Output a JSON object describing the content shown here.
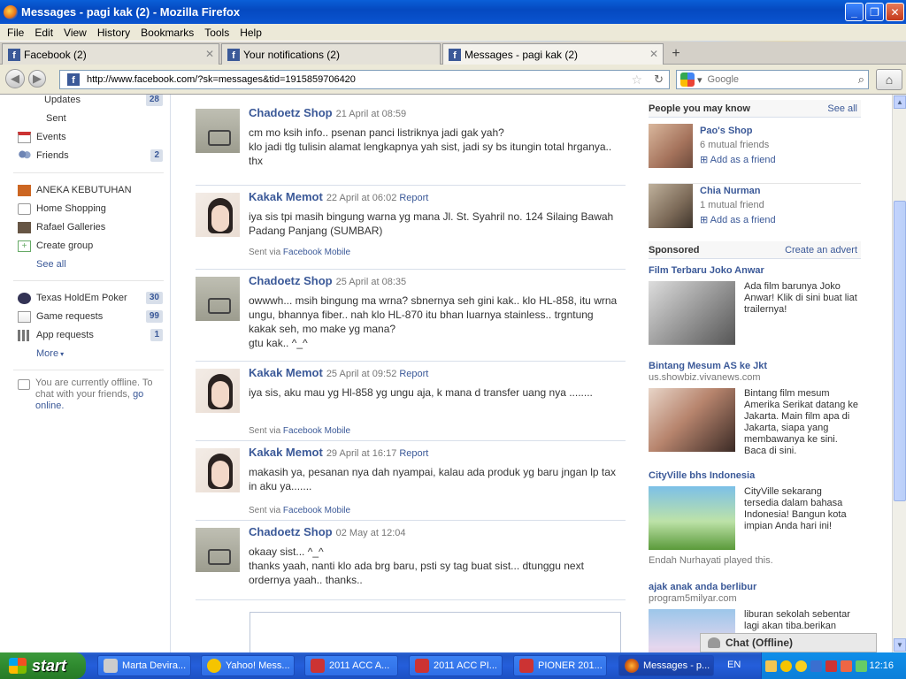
{
  "window": {
    "title": "Messages - pagi kak (2) - Mozilla Firefox"
  },
  "menu": [
    "File",
    "Edit",
    "View",
    "History",
    "Bookmarks",
    "Tools",
    "Help"
  ],
  "tabs": [
    {
      "label": "Facebook (2)"
    },
    {
      "label": "Your notifications (2)"
    },
    {
      "label": "Messages - pagi kak (2)"
    }
  ],
  "url": "http://www.facebook.com/?sk=messages&tid=1915859706420",
  "search": {
    "placeholder": "Google"
  },
  "left_nav": {
    "updates": {
      "label": "Updates",
      "count": "28"
    },
    "sent": {
      "label": "Sent"
    },
    "events": {
      "label": "Events"
    },
    "friends": {
      "label": "Friends",
      "count": "2"
    },
    "groups": [
      {
        "label": "ANEKA KEBUTUHAN"
      },
      {
        "label": "Home Shopping"
      },
      {
        "label": "Rafael Galleries"
      },
      {
        "label": "Create group"
      }
    ],
    "see_all": "See all",
    "apps": [
      {
        "label": "Texas HoldEm Poker",
        "count": "30"
      },
      {
        "label": "Game requests",
        "count": "99"
      },
      {
        "label": "App requests",
        "count": "1"
      }
    ],
    "more": "More",
    "offline_text": "You are currently offline. To chat with your friends,",
    "go_online": "go online."
  },
  "messages": [
    {
      "name": "Chadoetz Shop",
      "date": "21 April at 08:59",
      "report": "",
      "body": "cm mo ksih info.. psenan panci listriknya jadi gak yah?\nklo jadi tlg tulisin alamat lengkapnya yah sist, jadi sy bs itungin total hrganya.. thx",
      "via": ""
    },
    {
      "name": "Kakak Memot",
      "date": "22 April at 06:02",
      "report": "Report",
      "body": "iya sis tpi masih bingung warna yg mana Jl. St. Syahril no. 124 Silaing Bawah Padang Panjang (SUMBAR)",
      "via": "Facebook Mobile"
    },
    {
      "name": "Chadoetz Shop",
      "date": "25 April at 08:35",
      "report": "",
      "body": "owwwh... msih bingung ma wrna? sbnernya seh gini kak.. klo HL-858, itu wrna ungu, bhannya fiber.. nah klo HL-870 itu bhan luarnya stainless.. trgntung kakak seh, mo make yg mana?\ngtu kak.. ^_^",
      "via": ""
    },
    {
      "name": "Kakak Memot",
      "date": "25 April at 09:52",
      "report": "Report",
      "body": "iya sis, aku mau yg Hl-858 yg ungu aja, k mana d transfer uang nya ........",
      "via": "Facebook Mobile"
    },
    {
      "name": "Kakak Memot",
      "date": "29 April at 16:17",
      "report": "Report",
      "body": "makasih ya, pesanan nya dah nyampai, kalau ada produk yg baru jngan lp tax in aku ya.......",
      "via": "Facebook Mobile"
    },
    {
      "name": "Chadoetz Shop",
      "date": "02 May at 12:04",
      "report": "",
      "body": "okaay sist... ^_^\nthanks yaah, nanti klo ada brg baru, psti sy tag buat sist... dtunggu next ordernya yaah.. thanks..",
      "via": ""
    }
  ],
  "via_prefix": "Sent via",
  "pymk": {
    "title": "People you may know",
    "see_all": "See all",
    "people": [
      {
        "name": "Pao's Shop",
        "mutual": "6 mutual friends",
        "add": "Add as a friend"
      },
      {
        "name": "Chia Nurman",
        "mutual": "1 mutual friend",
        "add": "Add as a friend"
      }
    ]
  },
  "sponsored": {
    "title": "Sponsored",
    "create": "Create an advert",
    "ads": [
      {
        "title": "Film Terbaru Joko Anwar",
        "domain": "",
        "text": "Ada film barunya Joko Anwar! Klik di sini buat liat trailernya!",
        "footer": ""
      },
      {
        "title": "Bintang Mesum AS ke Jkt",
        "domain": "us.showbiz.vivanews.com",
        "text": "Bintang film mesum Amerika Serikat datang ke Jakarta. Main film apa di Jakarta, siapa yang membawanya ke sini. Baca di sini.",
        "footer": ""
      },
      {
        "title": "CityVille bhs Indonesia",
        "domain": "",
        "text": "CityVille sekarang tersedia dalam bahasa Indonesia! Bangun kota impian Anda hari ini!",
        "footer": "Endah Nurhayati played this."
      },
      {
        "title": "ajak anak anda berlibur",
        "domain": "program5milyar.com",
        "text": "liburan sekolah sebentar lagi akan tiba.berikan",
        "footer": ""
      }
    ]
  },
  "chat": {
    "label": "Chat (Offline)"
  },
  "taskbar": {
    "start": "start",
    "tasks": [
      "Marta Devira...",
      "Yahoo! Mess...",
      "2011 ACC A...",
      "2011 ACC PI...",
      "PIONER 201...",
      "Messages - p..."
    ],
    "lang": "EN",
    "clock": "12:16"
  }
}
